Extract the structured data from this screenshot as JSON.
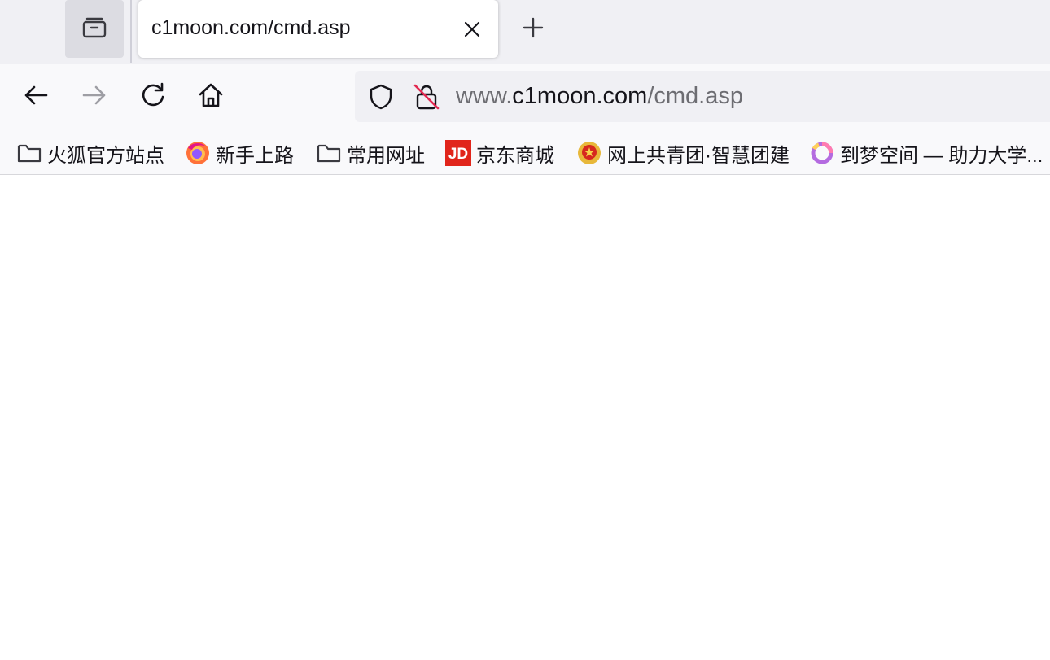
{
  "tab": {
    "title": "c1moon.com/cmd.asp"
  },
  "icons": {
    "overview": "tab-overview-icon",
    "close": "close-icon",
    "new_tab": "plus-icon",
    "back": "back-arrow-icon",
    "forward": "forward-arrow-icon",
    "reload": "reload-icon",
    "home": "home-icon",
    "shield": "tracking-shield-icon",
    "insecure": "insecure-lock-icon"
  },
  "url": {
    "prefix": "www.",
    "host": "c1moon.com",
    "path": "/cmd.asp"
  },
  "bookmarks": [
    {
      "label": "火狐官方站点",
      "icon": "folder-icon"
    },
    {
      "label": "新手上路",
      "icon": "firefox-icon"
    },
    {
      "label": "常用网址",
      "icon": "folder-icon"
    },
    {
      "label": "京东商城",
      "icon": "jd-logo-icon",
      "icon_text": "JD"
    },
    {
      "label": "网上共青团·智慧团建",
      "icon": "youth-league-icon"
    },
    {
      "label": "到梦空间 — 助力大学...",
      "icon": "dream-space-icon"
    }
  ],
  "colors": {
    "tabstrip": "#f0f0f4",
    "toolbar": "#f9f9fb",
    "jd_red": "#e1251b",
    "insecure_strike": "#e22850"
  }
}
